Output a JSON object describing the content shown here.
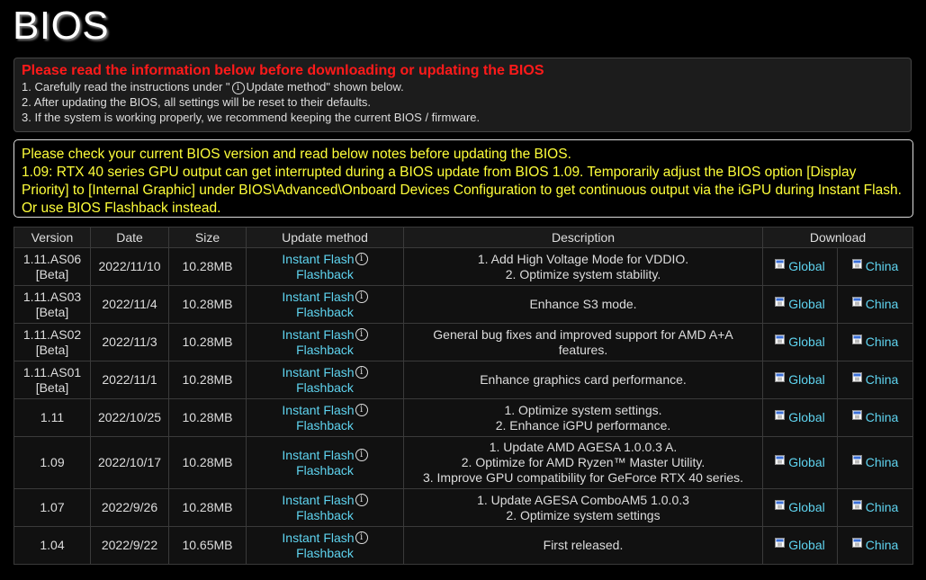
{
  "page_title": "BIOS",
  "warning": {
    "title": "Please read the information below before downloading or updating the BIOS",
    "line1_pre": "1. Carefully read the instructions under \"",
    "line1_post": "Update method\" shown below.",
    "line2": "2. After updating the BIOS, all settings will be reset to their defaults.",
    "line3": "3. If the system is working properly, we recommend keeping the current BIOS / firmware."
  },
  "note": {
    "line1": "Please check your current BIOS version and read below notes before updating the BIOS.",
    "line2": "1.09: RTX 40 series GPU output can get interrupted during a BIOS update from BIOS 1.09. Temporarily adjust the BIOS option [Display Priority] to [Internal Graphic] under BIOS\\Advanced\\Onboard Devices Configuration to get continuous output via the iGPU during Instant Flash. Or use BIOS Flashback instead."
  },
  "table": {
    "headers": {
      "version": "Version",
      "date": "Date",
      "size": "Size",
      "method": "Update method",
      "description": "Description",
      "download": "Download"
    },
    "method": {
      "instant": "Instant Flash",
      "flashback": "Flashback"
    },
    "download": {
      "global": "Global",
      "china": "China"
    },
    "rows": [
      {
        "version": "1.11.AS06",
        "tag": "[Beta]",
        "date": "2022/11/10",
        "size": "10.28MB",
        "desc": [
          "1. Add High Voltage Mode for VDDIO.",
          "2. Optimize system stability."
        ]
      },
      {
        "version": "1.11.AS03",
        "tag": "[Beta]",
        "date": "2022/11/4",
        "size": "10.28MB",
        "desc": [
          "Enhance S3 mode."
        ]
      },
      {
        "version": "1.11.AS02",
        "tag": "[Beta]",
        "date": "2022/11/3",
        "size": "10.28MB",
        "desc": [
          "General bug fixes and improved support for AMD A+A",
          "features."
        ]
      },
      {
        "version": "1.11.AS01",
        "tag": "[Beta]",
        "date": "2022/11/1",
        "size": "10.28MB",
        "desc": [
          "Enhance graphics card performance."
        ]
      },
      {
        "version": "1.11",
        "tag": "",
        "date": "2022/10/25",
        "size": "10.28MB",
        "desc": [
          "1. Optimize system settings.",
          "2. Enhance iGPU performance."
        ]
      },
      {
        "version": "1.09",
        "tag": "",
        "date": "2022/10/17",
        "size": "10.28MB",
        "desc": [
          "1. Update AMD AGESA 1.0.0.3 A.",
          "2. Optimize for AMD Ryzen™ Master Utility.",
          "3. Improve GPU compatibility for GeForce RTX 40 series."
        ]
      },
      {
        "version": "1.07",
        "tag": "",
        "date": "2022/9/26",
        "size": "10.28MB",
        "desc": [
          "1. Update AGESA ComboAM5 1.0.0.3",
          "2. Optimize system settings"
        ]
      },
      {
        "version": "1.04",
        "tag": "",
        "date": "2022/9/22",
        "size": "10.65MB",
        "desc": [
          "First released."
        ]
      }
    ]
  },
  "colors": {
    "warning_title": "#ff1a1a",
    "note_text": "#ffff3a",
    "link": "#5fd4f0"
  }
}
